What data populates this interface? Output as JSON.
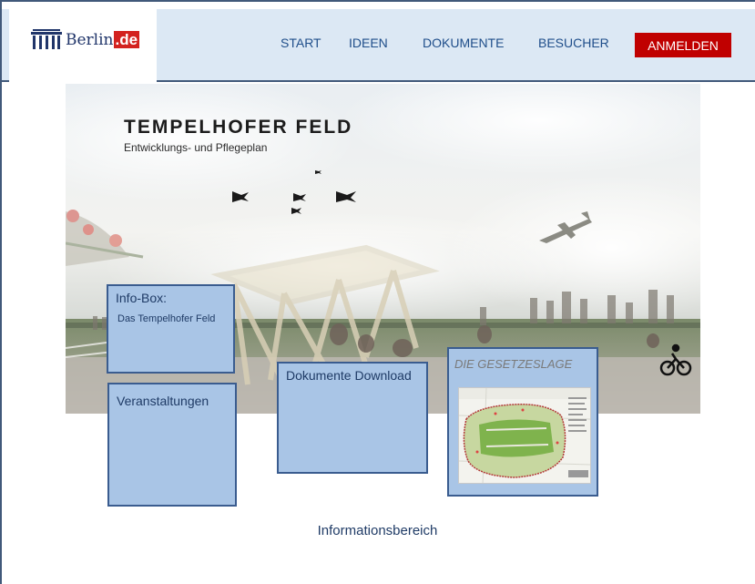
{
  "logo": {
    "text": "Berlin",
    "suffix": ".de"
  },
  "nav": {
    "items": [
      "START",
      "IDEEN",
      "DOKUMENTE",
      "BESUCHER"
    ],
    "login": "ANMELDEN"
  },
  "hero": {
    "title": "TEMPELHOFER FELD",
    "subtitle": "Entwicklungs- und Pflegeplan"
  },
  "boxes": {
    "info": {
      "title": "Info-Box:",
      "subtitle": "Das Tempelhofer Feld"
    },
    "events": {
      "title": "Veranstaltungen"
    },
    "documents": {
      "title": "Dokumente Download"
    },
    "law": {
      "title": "DIE GESETZESLAGE"
    }
  },
  "footer": {
    "info_area": "Informationsbereich"
  },
  "colors": {
    "accent": "#c00000",
    "header_bg": "#dce8f4",
    "box_bg": "#a9c5e6",
    "border": "#3a5c8f"
  },
  "icons": [
    "brandenburg-gate-icon",
    "bicycle-icon",
    "birds-icon",
    "airplane-icon"
  ]
}
